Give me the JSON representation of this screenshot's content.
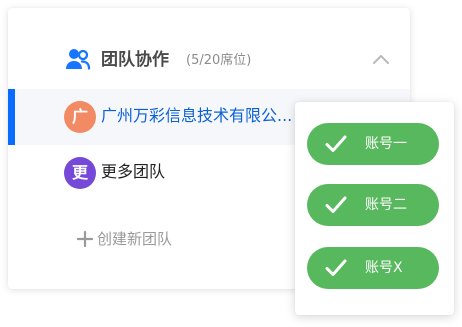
{
  "team_panel": {
    "header": {
      "title": "团队协作",
      "seat_info": "(5/20席位)",
      "icon": "users-icon"
    },
    "teams": [
      {
        "avatar": "广",
        "name": "广州万彩信息技术有限公...",
        "avatar_color": "#f28a63",
        "selected": true
      },
      {
        "avatar": "更",
        "name": "更多团队",
        "avatar_color": "#7648d8",
        "selected": false
      }
    ],
    "create_team_label": "创建新团队"
  },
  "account_popup": {
    "accounts": [
      {
        "label": "账号一",
        "checked": true
      },
      {
        "label": "账号二",
        "checked": true
      },
      {
        "label": "账号X",
        "checked": true
      }
    ]
  },
  "colors": {
    "accent": "#0a6cff",
    "selected_text": "#0b61d8",
    "account_pill": "#58b85d"
  }
}
